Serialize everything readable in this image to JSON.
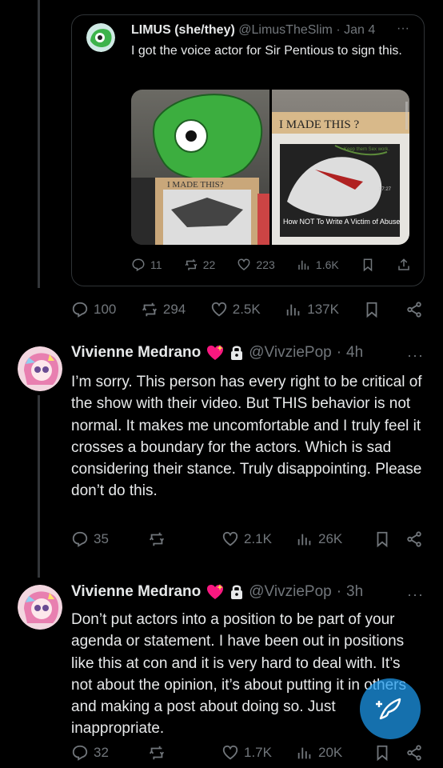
{
  "quoted": {
    "display_name": "LIMUS (she/they)",
    "handle": "@LimusTheSlim",
    "date": "Jan 4",
    "text": "I got the voice actor for Sir Pentious to sign this.",
    "sign_left": "I MADE THIS?",
    "sign_right": "I MADE THIS ?",
    "video_title": "How NOT To Write A Victim of Abuse",
    "video_time": "17:27",
    "signature_note": "Keep them\nSex work.",
    "video_title_small": "How NOT To Write A Victim of",
    "stats": {
      "replies": "11",
      "reposts": "22",
      "likes": "223",
      "views": "1.6K"
    }
  },
  "parent_stats": {
    "replies": "100",
    "reposts": "294",
    "likes": "2.5K",
    "views": "137K"
  },
  "tweets": [
    {
      "display_name": "Vivienne Medrano",
      "handle": "@VivziePop",
      "time": "4h",
      "text": "I’m sorry. This person has every right to be critical of the show with their video. But THIS behavior is not normal. It makes me uncomfortable and I truly feel it crosses a boundary for the actors. Which is sad considering their stance. Truly disappointing. Please don’t do this.",
      "stats": {
        "replies": "35",
        "reposts": "",
        "likes": "2.1K",
        "views": "26K"
      }
    },
    {
      "display_name": "Vivienne Medrano",
      "handle": "@VivziePop",
      "time": "3h",
      "text": "Don’t put actors into a position to be part of your agenda or statement. I have been out in positions like this at con and it is very hard to deal with. It’s not about the opinion, it’s about putting it in others and making a post about doing so. Just inappropriate.",
      "stats": {
        "replies": "32",
        "reposts": "",
        "likes": "1.7K",
        "views": "20K"
      }
    }
  ],
  "ui": {
    "more": "···",
    "separator": "·"
  },
  "colors": {
    "background": "#000000",
    "text": "#e7e9ea",
    "muted": "#71767b",
    "accent": "#1d9bf0",
    "heart": "#f91880"
  }
}
